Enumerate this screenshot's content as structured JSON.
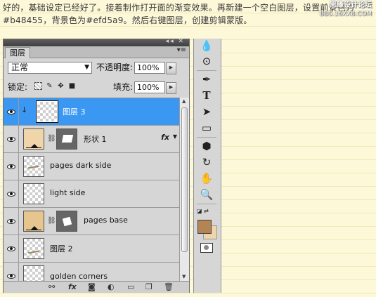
{
  "intro_text": "好的，基础设定已经好了。接着制作打开面的渐变效果。再新建一个空白图层，设置前景色为#b48455，背景色为#efd5a9。然后右键图层，创建剪辑蒙版。",
  "watermark": {
    "line1": "思缘设计论坛",
    "line2": "BBS.16XX8.COM"
  },
  "panel": {
    "tab_label": "图层",
    "blend_mode": "正常",
    "opacity_label": "不透明度:",
    "opacity_value": "100%",
    "lock_label": "锁定:",
    "fill_label": "填充:",
    "fill_value": "100%"
  },
  "layers": [
    {
      "name": "图层 3",
      "selected": true,
      "type": "clip-layer"
    },
    {
      "name": "形状 1",
      "selected": false,
      "type": "shape",
      "fx": "fx",
      "fill_color": "#efd5a9"
    },
    {
      "name": "pages dark side",
      "selected": false,
      "type": "pixel"
    },
    {
      "name": "light side",
      "selected": false,
      "type": "pixel"
    },
    {
      "name": "pages base",
      "selected": false,
      "type": "shape",
      "fill_color": "#e7c58e"
    },
    {
      "name": "图层 2",
      "selected": false,
      "type": "pixel"
    },
    {
      "name": "golden corners",
      "selected": false,
      "type": "pixel"
    }
  ],
  "colors": {
    "foreground": "#b48455",
    "background": "#efd5a9",
    "selection": "#3b98f2"
  }
}
